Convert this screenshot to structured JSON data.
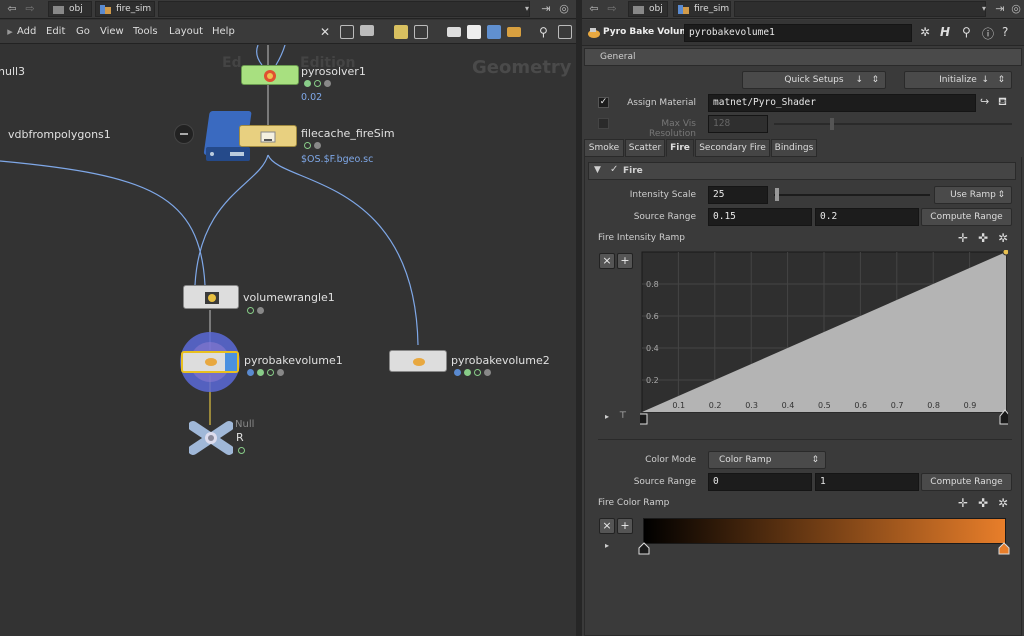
{
  "left_pane": {
    "path": {
      "root": "obj",
      "network": "fire_sim"
    },
    "menu": [
      "Add",
      "Edit",
      "Go",
      "View",
      "Tools",
      "Layout",
      "Help"
    ],
    "watermark_context": "Geometry",
    "watermark_edition": "Edition",
    "watermark_edition_prefix": "Ed",
    "nodes": {
      "null3": {
        "label": "null3"
      },
      "vdb": {
        "label": "vdbfrompolygons1"
      },
      "pyrosolver": {
        "label": "pyrosolver1",
        "sub": "0.02"
      },
      "filecache": {
        "label": "filecache_fireSim",
        "sub": "$OS.$F.bgeo.sc"
      },
      "volumewrangle": {
        "label": "volumewrangle1"
      },
      "pyrobake1": {
        "label": "pyrobakevolume1"
      },
      "pyrobake2": {
        "label": "pyrobakevolume2"
      },
      "null_r": {
        "type": "Null",
        "label": "R"
      }
    }
  },
  "right_pane": {
    "path": {
      "root": "obj",
      "network": "fire_sim"
    },
    "node_type": "Pyro Bake Volume",
    "node_name": "pyrobakevolume1",
    "folder": "General",
    "quick_setups": "Quick Setups",
    "initialize": "Initialize",
    "assign_material": {
      "label": "Assign Material",
      "checked": true,
      "value": "matnet/Pyro_Shader"
    },
    "max_vis_resolution": {
      "label": "Max Vis Resolution",
      "value": "128",
      "checked": false
    },
    "tabs": [
      "Smoke",
      "Scatter",
      "Fire",
      "Secondary Fire",
      "Bindings"
    ],
    "active_tab": "Fire",
    "fire_section": {
      "label": "Fire",
      "enabled": true
    },
    "intensity_scale": {
      "label": "Intensity Scale",
      "value": "25",
      "button": "Use Ramp",
      "slider_fraction": 0.03
    },
    "source_range": {
      "label": "Source Range",
      "min": "0.15",
      "max": "0.2",
      "button": "Compute Range"
    },
    "intensity_ramp": {
      "label": "Fire Intensity Ramp",
      "points": [
        [
          0,
          0
        ],
        [
          1,
          1
        ]
      ],
      "x_ticks": [
        "0.1",
        "0.2",
        "0.3",
        "0.4",
        "0.5",
        "0.6",
        "0.7",
        "0.8",
        "0.9"
      ],
      "y_ticks": [
        "0.2",
        "0.4",
        "0.6",
        "0.8"
      ]
    },
    "color_mode": {
      "label": "Color Mode",
      "value": "Color Ramp"
    },
    "color_source_range": {
      "label": "Source Range",
      "min": "0",
      "max": "1",
      "button": "Compute Range"
    },
    "color_ramp": {
      "label": "Fire Color Ramp",
      "start_color": "#000000",
      "end_color": "#e87e2a"
    }
  },
  "colors": {
    "accent_blue": "#7fa8e8",
    "ramp_fill": "#b4b4b4",
    "pyrosolver_green": "#a8e080",
    "filecache_yellow": "#e8d080"
  }
}
